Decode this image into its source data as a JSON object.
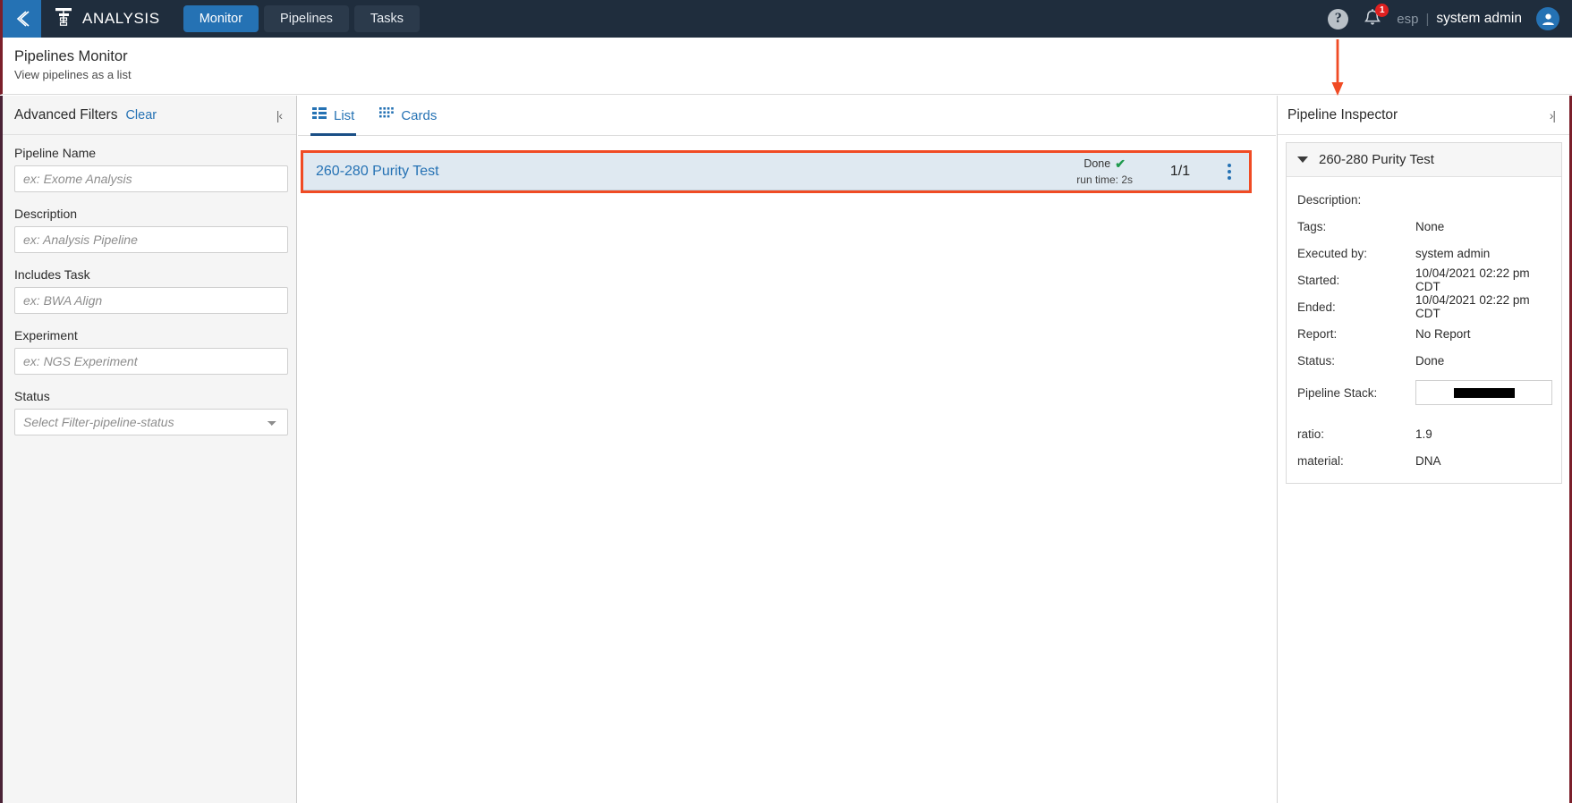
{
  "topnav": {
    "back_icon": "chevron-left-icon",
    "logo_icon": "pipeline-tree-icon",
    "brand": "ANALYSIS",
    "tabs": [
      {
        "label": "Monitor",
        "active": true
      },
      {
        "label": "Pipelines",
        "active": false
      },
      {
        "label": "Tasks",
        "active": false
      }
    ],
    "help_icon": "question-mark-icon",
    "help_glyph": "?",
    "bell_icon": "bell-icon",
    "notification_count": "1",
    "language": "esp",
    "separator": "|",
    "user": "system admin",
    "avatar_icon": "user-avatar-icon",
    "accent": "#2572b4",
    "background": "#1f2d3d"
  },
  "page": {
    "title": "Pipelines Monitor",
    "subtitle": "View pipelines as a list"
  },
  "filters": {
    "heading": "Advanced Filters",
    "clear_label": "Clear",
    "collapse_icon": "collapse-left-icon",
    "collapse_glyph": "|‹",
    "fields": [
      {
        "label": "Pipeline Name",
        "placeholder": "ex: Exome Analysis",
        "value": "",
        "type": "text"
      },
      {
        "label": "Description",
        "placeholder": "ex: Analysis Pipeline",
        "value": "",
        "type": "text"
      },
      {
        "label": "Includes Task",
        "placeholder": "ex: BWA Align",
        "value": "",
        "type": "text"
      },
      {
        "label": "Experiment",
        "placeholder": "ex: NGS Experiment",
        "value": "",
        "type": "text"
      }
    ],
    "status_field": {
      "label": "Status",
      "selected": "Select Filter-pipeline-status"
    }
  },
  "center": {
    "view_tabs": [
      {
        "label": "List",
        "icon": "list-view-icon",
        "active": true
      },
      {
        "label": "Cards",
        "icon": "cards-view-icon",
        "active": false
      }
    ],
    "rows": [
      {
        "name": "260-280 Purity Test",
        "status": "Done",
        "status_icon": "checkmark-icon",
        "status_glyph": "✔",
        "runtime": "run time: 2s",
        "count": "1/1",
        "menu_icon": "kebab-menu-icon",
        "highlighted": true
      }
    ],
    "highlight_color": "#f04b24",
    "row_background": "#dfe9f1"
  },
  "inspector": {
    "title": "Pipeline Inspector",
    "expand_icon": "expand-right-icon",
    "expand_glyph": "›|",
    "card_title": "260-280 Purity Test",
    "caret_icon": "caret-down-icon",
    "details": [
      {
        "key": "Description:",
        "value": ""
      },
      {
        "key": "Tags:",
        "value": "None"
      },
      {
        "key": "Executed by:",
        "value": "system admin"
      },
      {
        "key": "Started:",
        "value": "10/04/2021 02:22 pm CDT"
      },
      {
        "key": "Ended:",
        "value": "10/04/2021 02:22 pm CDT"
      },
      {
        "key": "Report:",
        "value": "No Report"
      },
      {
        "key": "Status:",
        "value": "Done"
      }
    ],
    "stack_key": "Pipeline Stack:",
    "stack_value_redacted": true,
    "extras": [
      {
        "key": "ratio:",
        "value": "1.9"
      },
      {
        "key": "material:",
        "value": "DNA"
      }
    ]
  },
  "annotation": {
    "arrow_icon": "red-down-arrow-annotation",
    "color": "#f04b24"
  }
}
